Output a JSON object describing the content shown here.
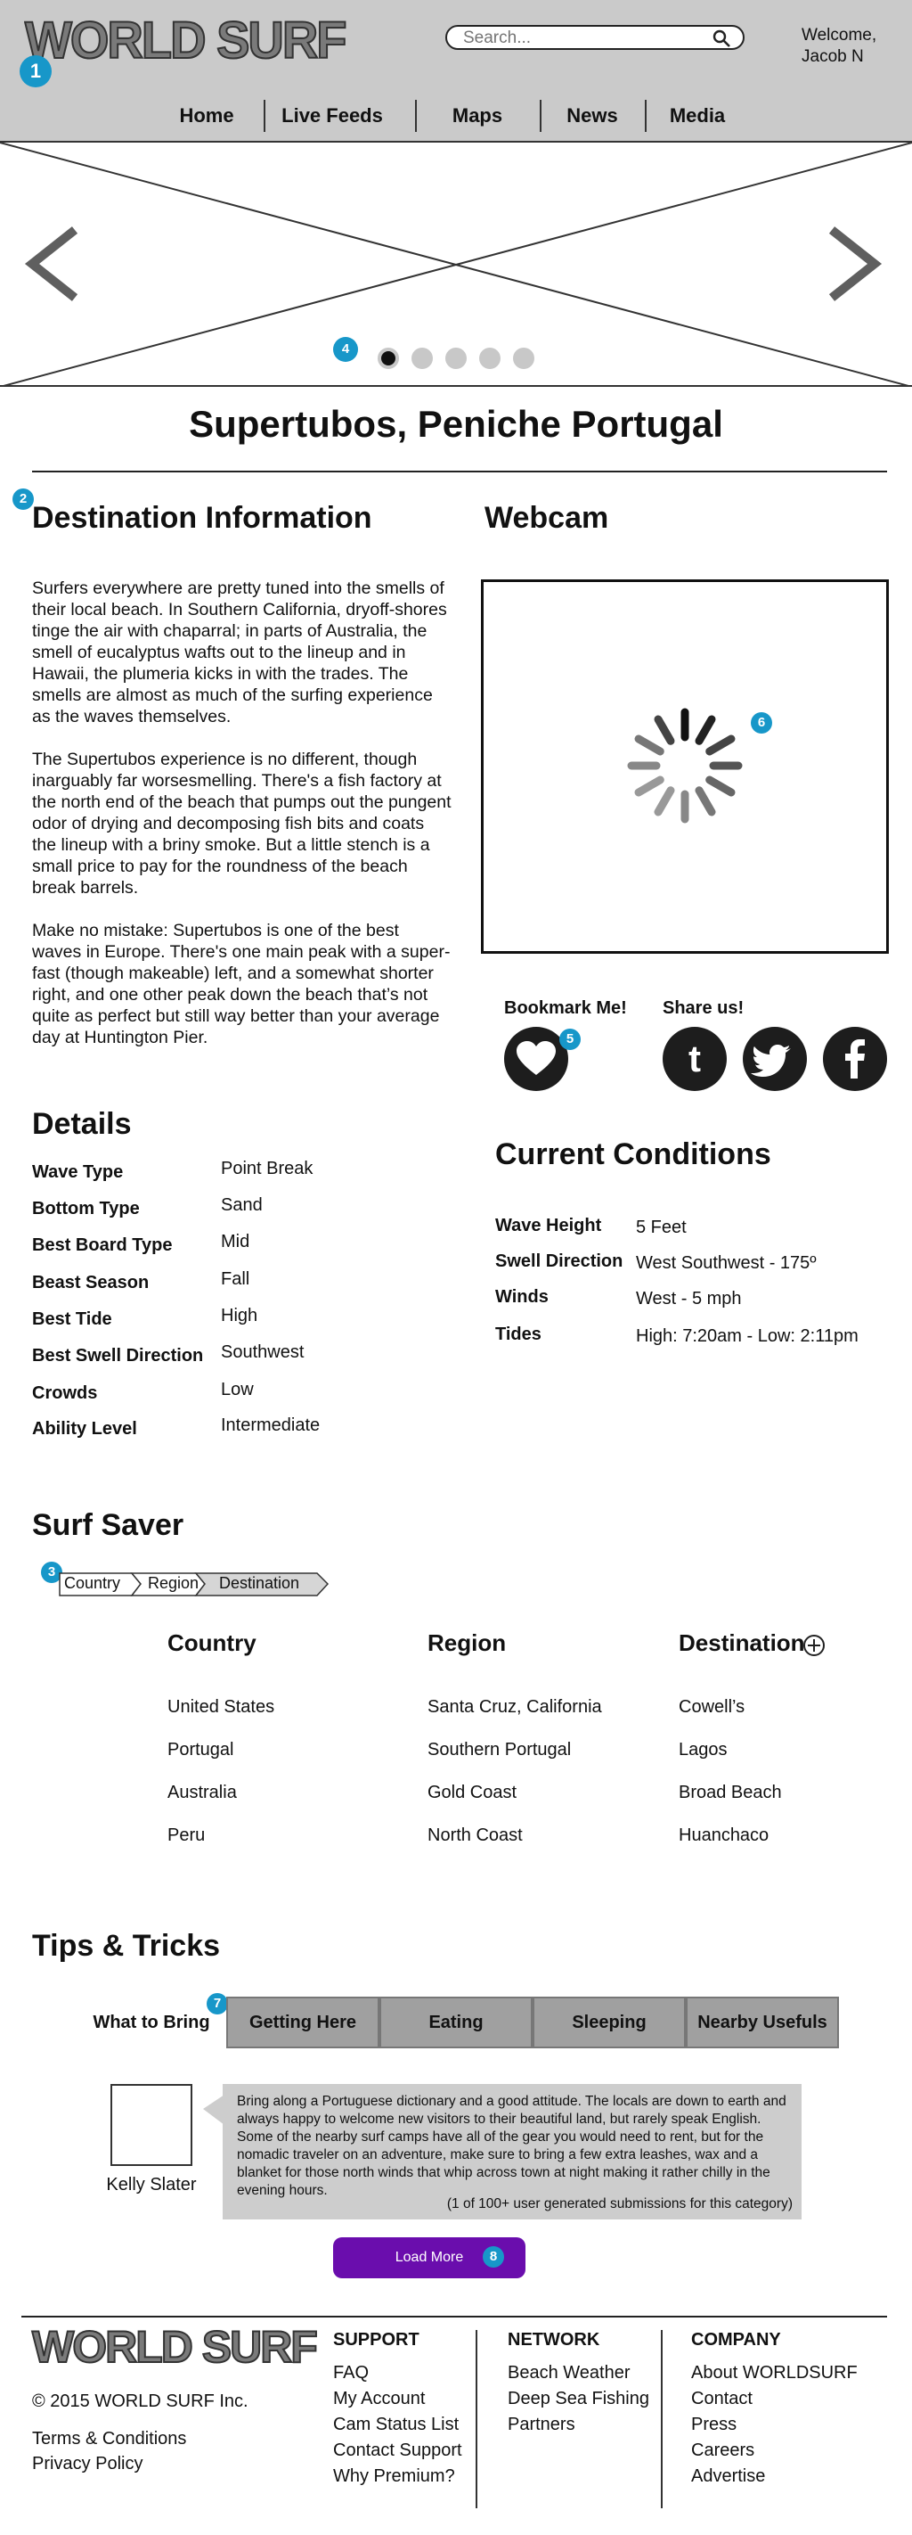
{
  "header": {
    "logo": "WORLD SURF",
    "search_placeholder": "Search...",
    "welcome": "Welcome, Jacob N",
    "nav": [
      "Home",
      "Live Feeds",
      "Maps",
      "News",
      "Media"
    ]
  },
  "annotations": [
    "1",
    "2",
    "3",
    "4",
    "5",
    "6",
    "7",
    "8"
  ],
  "page_title": "Supertubos, Peniche Portugal",
  "destination": {
    "heading": "Destination Information",
    "paragraphs": [
      "Surfers everywhere are pretty tuned into the smells of their local beach. In Southern California, dryoff-shores tinge the air with chaparral; in parts of Australia, the smell of eucalyptus wafts out to the lineup and in Hawaii, the plumeria kicks in with the trades. The smells are almost as much of the surfing experience as the waves themselves.",
      "The Supertubos experience is no different, though inarguably far worsesmelling. There's a fish factory at the north end of the beach that pumps out the pungent odor of drying and decomposing fish bits and coats the lineup with a briny smoke. But a little stench is a small price to pay for the roundness of the beach break barrels.",
      "Make no mistake: Supertubos is one of the best waves in Europe. There's one main peak with a super-fast (though makeable) left, and a somewhat shorter right, and one other peak down the beach that’s  not quite as perfect but still way better than your average day at Huntington Pier."
    ]
  },
  "webcam": {
    "heading": "Webcam"
  },
  "social": {
    "bookmark": "Bookmark Me!",
    "share": "Share us!"
  },
  "details": {
    "heading": "Details",
    "rows": [
      {
        "label": "Wave Type",
        "value": "Point Break"
      },
      {
        "label": "Bottom Type",
        "value": "Sand"
      },
      {
        "label": "Best Board Type",
        "value": "Mid"
      },
      {
        "label": "Beast Season",
        "value": "Fall"
      },
      {
        "label": "Best Tide",
        "value": "High"
      },
      {
        "label": "Best Swell Direction",
        "value": "Southwest"
      },
      {
        "label": "Crowds",
        "value": "Low"
      },
      {
        "label": "Ability Level",
        "value": "Intermediate"
      }
    ]
  },
  "conditions": {
    "heading": "Current Conditions",
    "rows": [
      {
        "label": "Wave Height",
        "value": "5 Feet"
      },
      {
        "label": "Swell Direction",
        "value": "West Southwest - 175º"
      },
      {
        "label": "Winds",
        "value": "West - 5 mph"
      },
      {
        "label": "Tides",
        "value": "High: 7:20am - Low: 2:11pm"
      }
    ]
  },
  "surf_saver": {
    "heading": "Surf Saver",
    "breadcrumb": [
      "Country",
      "Region",
      "Destination"
    ],
    "columns": [
      "Country",
      "Region",
      "Destination"
    ],
    "rows": [
      [
        "United States",
        "Santa Cruz, California",
        "Cowell’s"
      ],
      [
        "Portugal",
        "Southern Portugal",
        "Lagos"
      ],
      [
        "Australia",
        "Gold Coast",
        "Broad Beach"
      ],
      [
        "Peru",
        "North Coast",
        "Huanchaco"
      ]
    ]
  },
  "tips": {
    "heading": "Tips & Tricks",
    "tabs": [
      "What to Bring",
      "Getting Here",
      "Eating",
      "Sleeping",
      "Nearby Usefuls"
    ],
    "author": "Kelly Slater",
    "tip": "Bring along a Portuguese dictionary and a good attitude. The locals are down to earth and always happy to welcome new visitors to their beautiful land, but rarely speak English. Some of the nearby surf camps have all of the gear you would need to rent, but for the nomadic traveler on an adventure, make sure to bring a few extra leashes, wax and a blanket for those north winds that whip across town at night making it rather chilly in the evening hours.",
    "note": "(1 of 100+ user generated submissions for this category)",
    "load_more": "Load More"
  },
  "footer": {
    "logo": "WORLD SURF",
    "copyright": "© 2015 WORLD SURF Inc.",
    "legal": [
      "Terms & Conditions",
      "Privacy Policy"
    ],
    "support": {
      "heading": "SUPPORT",
      "links": [
        "FAQ",
        "My Account",
        "Cam Status List",
        "Contact Support",
        "Why Premium?"
      ]
    },
    "network": {
      "heading": "NETWORK",
      "links": [
        "Beach Weather",
        "Deep Sea Fishing",
        "Partners"
      ]
    },
    "company": {
      "heading": "COMPANY",
      "links": [
        "About WORLDSURF",
        "Contact",
        "Press",
        "Careers",
        "Advertise"
      ]
    }
  }
}
